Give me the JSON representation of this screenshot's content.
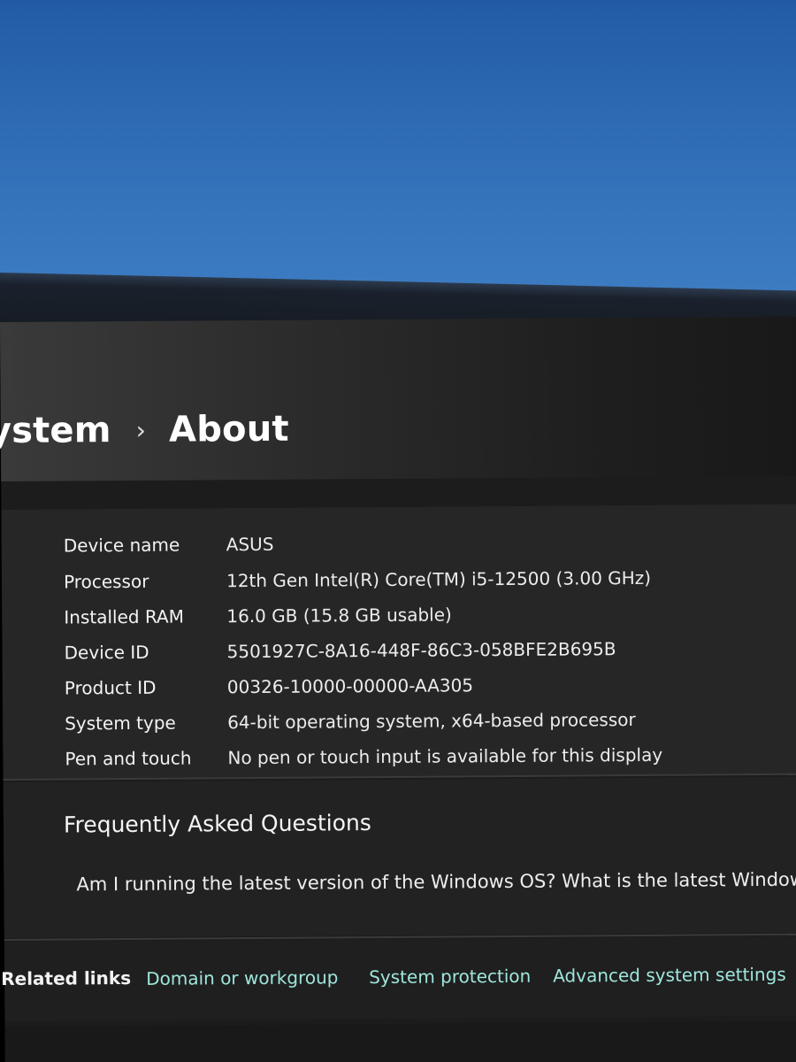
{
  "breadcrumb": {
    "parent": "ystem",
    "separator": "›",
    "current": "About"
  },
  "device_specs": [
    {
      "label": "Device name",
      "value": "ASUS"
    },
    {
      "label": "Processor",
      "value": "12th Gen Intel(R) Core(TM) i5-12500 (3.00 GHz)"
    },
    {
      "label": "Installed RAM",
      "value": "16.0 GB (15.8 GB usable)"
    },
    {
      "label": "Device ID",
      "value": "5501927C-8A16-448F-86C3-058BFE2B695B"
    },
    {
      "label": "Product ID",
      "value": "00326-10000-00000-AA305"
    },
    {
      "label": "System type",
      "value": "64-bit operating system, x64-based processor"
    },
    {
      "label": "Pen and touch",
      "value": "No pen or touch input is available for this display"
    }
  ],
  "faq": {
    "title": "Frequently Asked Questions",
    "question": "Am I running the latest version of the Windows OS? What is the latest Windows"
  },
  "related_links": {
    "label": "Related links",
    "items": [
      {
        "label": "Domain or workgroup"
      },
      {
        "label": "System protection"
      },
      {
        "label": "Advanced system settings"
      }
    ]
  },
  "colors": {
    "link": "#9fe6dc",
    "background": "#1c1c1c",
    "panel": "#262626"
  }
}
